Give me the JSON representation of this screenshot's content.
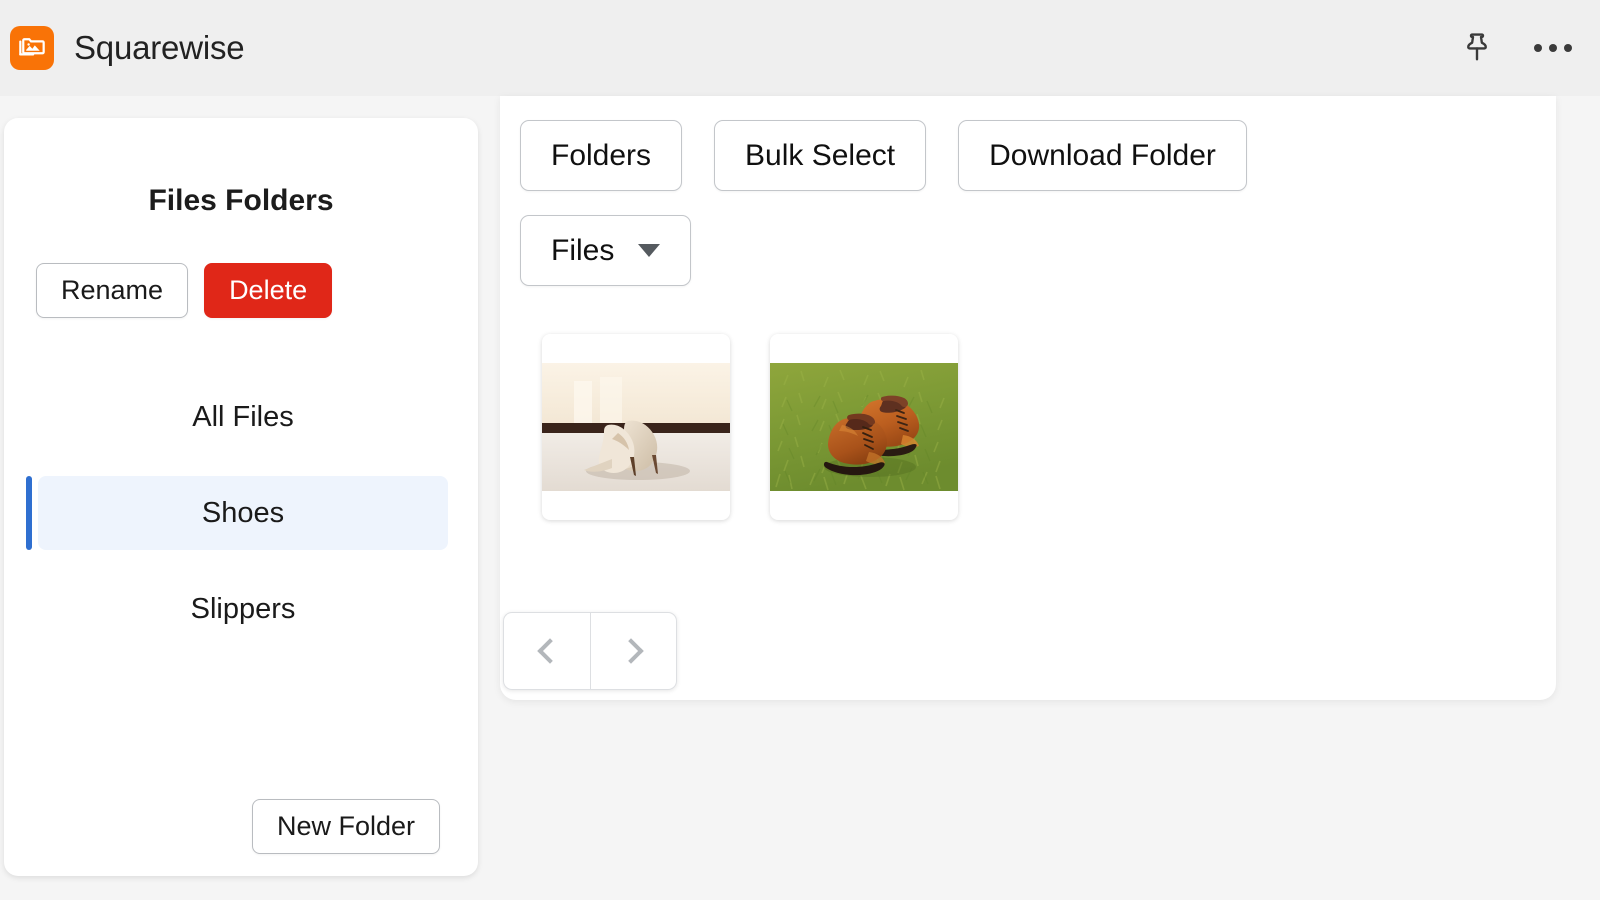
{
  "header": {
    "app_title": "Squarewise",
    "logo_icon": "photo-folder-icon",
    "logo_color": "#f97307",
    "pin_icon": "pushpin-icon",
    "more_icon": "more-options-icon"
  },
  "sidebar": {
    "title": "Files Folders",
    "rename_label": "Rename",
    "delete_label": "Delete",
    "delete_color": "#e02718",
    "new_folder_label": "New Folder",
    "selected_color": "#eef4fd",
    "accent_color": "#2f6fd0",
    "folders": [
      {
        "label": "All Files",
        "selected": false
      },
      {
        "label": "Shoes",
        "selected": true
      },
      {
        "label": "Slippers",
        "selected": false
      }
    ]
  },
  "main": {
    "toolbar": {
      "folders_label": "Folders",
      "bulk_select_label": "Bulk Select",
      "download_folder_label": "Download Folder",
      "files_dropdown_label": "Files",
      "caret_icon": "chevron-down-icon"
    },
    "thumbnails": [
      {
        "alt": "beige high heel pumps on dark wooden floor"
      },
      {
        "alt": "brown leather oxford shoes on green grass"
      }
    ],
    "pagination": {
      "prev_icon": "chevron-left-icon",
      "next_icon": "chevron-right-icon"
    }
  }
}
